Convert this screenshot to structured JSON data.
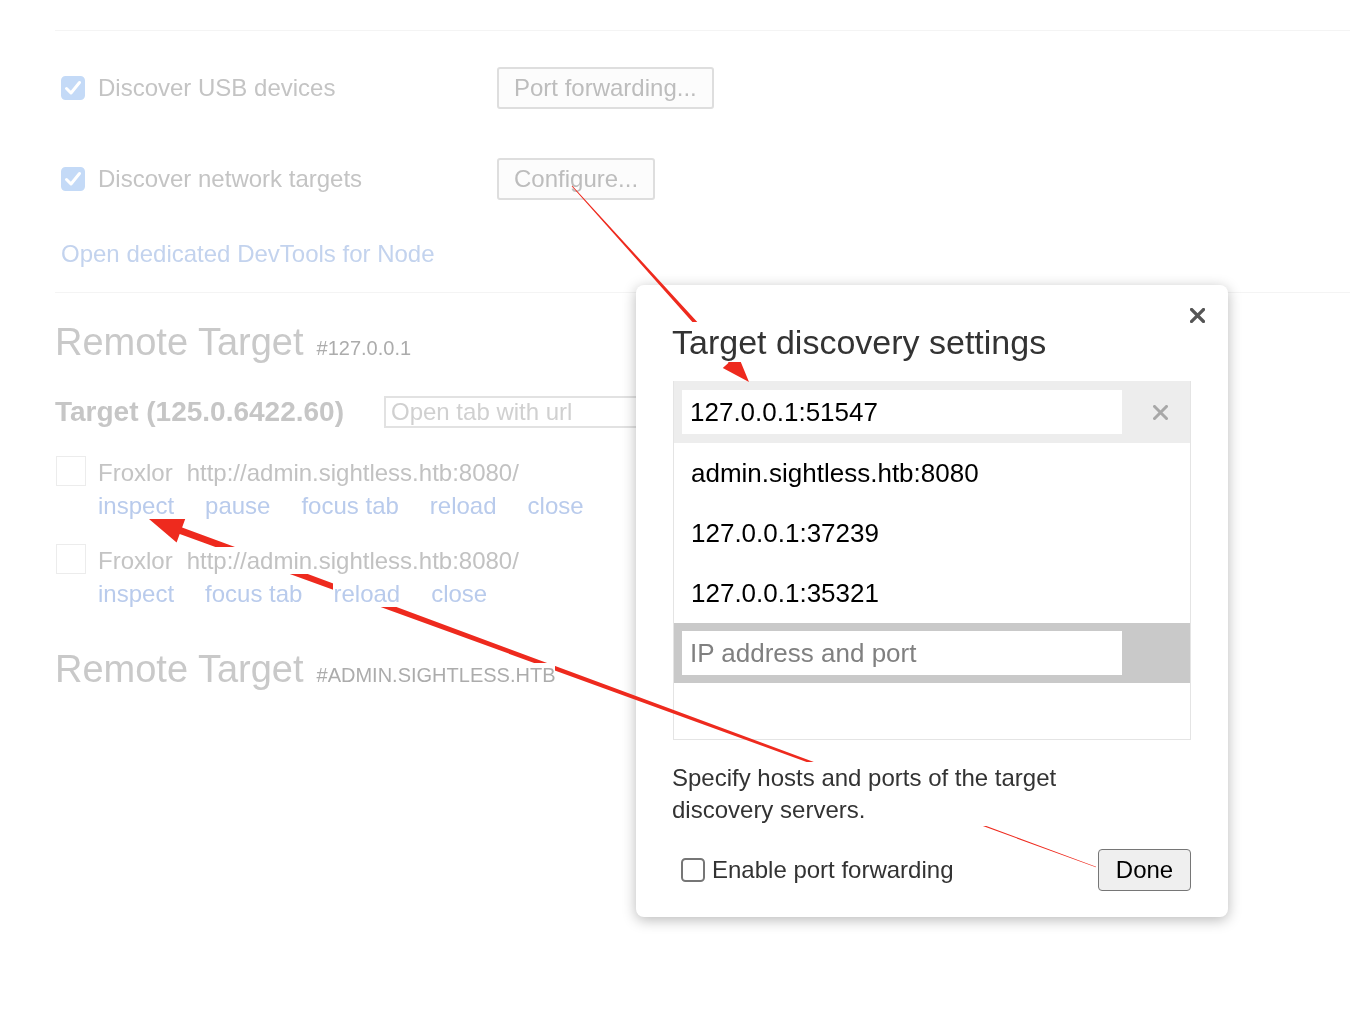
{
  "devices": {
    "options": [
      {
        "label": "Discover USB devices",
        "checked": true,
        "button": "Port forwarding..."
      },
      {
        "label": "Discover network targets",
        "checked": true,
        "button": "Configure..."
      }
    ],
    "node_link": "Open dedicated DevTools for Node"
  },
  "remote_targets": [
    {
      "title": "Remote Target",
      "host": "#127.0.0.1",
      "browser": "Target (125.0.6422.60)",
      "url_placeholder": "Open tab with url",
      "pages": [
        {
          "name": "Froxlor",
          "url": "http://admin.sightless.htb:8080/",
          "actions": [
            "inspect",
            "pause",
            "focus tab",
            "reload",
            "close"
          ]
        },
        {
          "name": "Froxlor",
          "url": "http://admin.sightless.htb:8080/",
          "actions": [
            "inspect",
            "focus tab",
            "reload",
            "close"
          ]
        }
      ]
    },
    {
      "title": "Remote Target",
      "host": "#ADMIN.SIGHTLESS.HTB"
    }
  ],
  "dialog": {
    "title": "Target discovery settings",
    "entries": [
      {
        "kind": "editing",
        "value": "127.0.0.1:51547"
      },
      {
        "kind": "item",
        "value": "admin.sightless.htb:8080"
      },
      {
        "kind": "item",
        "value": "127.0.0.1:37239"
      },
      {
        "kind": "item",
        "value": "127.0.0.1:35321"
      },
      {
        "kind": "new",
        "placeholder": "IP address and port"
      }
    ],
    "help": "Specify hosts and ports of the target discovery servers.",
    "port_forwarding": {
      "label": "Enable port forwarding",
      "checked": false
    },
    "done_button": "Done"
  }
}
